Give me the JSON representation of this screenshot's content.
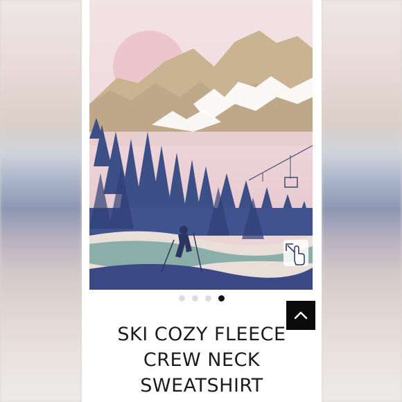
{
  "product": {
    "title_lines": [
      "SKI COZY FLEECE",
      "CREW NECK",
      "SWEATSHIRT"
    ]
  },
  "gallery": {
    "image_description_name": "ski-mountain-print-image",
    "dots_count": 4,
    "active_index": 3
  },
  "icons": {
    "expand": "pinch-zoom-hand-icon",
    "scroll_top": "chevron-up-icon"
  },
  "colors": {
    "accent_dark": "#0b0b0b",
    "dot_inactive": "#dcdcdc",
    "dot_active": "#111111",
    "title_text": "#1c1c1c"
  }
}
